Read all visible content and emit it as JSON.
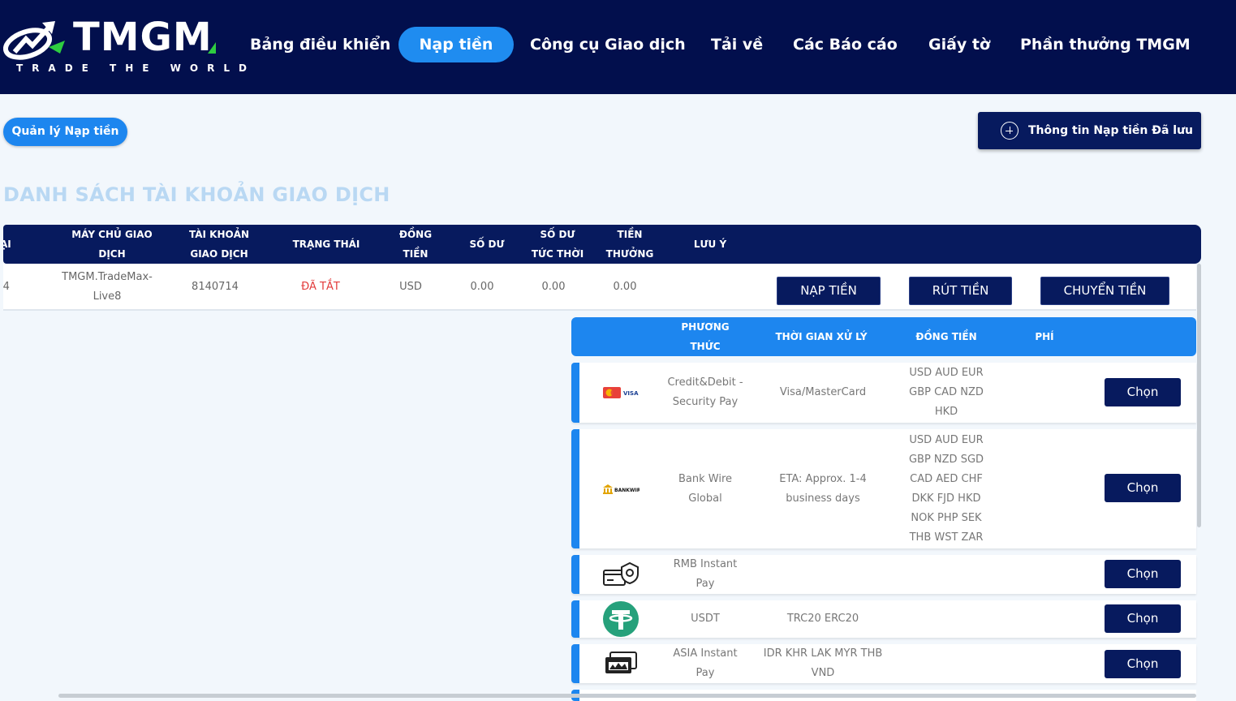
{
  "brand": {
    "name": "TMGM",
    "tagline": "TRADE THE WORLD"
  },
  "nav": {
    "items": [
      {
        "label": "Bảng điều khiển"
      },
      {
        "label": "Nạp tiền",
        "active": true
      },
      {
        "label": "Công cụ Giao dịch"
      },
      {
        "label": "Tải về"
      },
      {
        "label": "Các Báo cáo"
      },
      {
        "label": "Giấy tờ"
      },
      {
        "label": "Phần thưởng TMGM"
      }
    ]
  },
  "sub": {
    "manage_label": "Quản lý Nạp tiền",
    "saved_label": "Thông tin Nạp tiền Đã lưu"
  },
  "section_title": "DANH SÁCH TÀI KHOẢN GIAO DỊCH",
  "accounts": {
    "headers": [
      "ẠI",
      "MÁY CHỦ GIAO DỊCH",
      "TÀI KHOẢN GIAO DỊCH",
      "TRẠNG THÁI",
      "ĐỒNG TIỀN",
      "SỐ DƯ",
      "SỐ DƯ TỨC THỜI",
      "TIỀN THƯỞNG",
      "LƯU Ý"
    ],
    "row": {
      "type": "'4",
      "server": "TMGM.TradeMax-Live8",
      "account": "8140714",
      "status": "ĐÃ TẮT",
      "currency": "USD",
      "balance": "0.00",
      "instant_balance": "0.00",
      "bonus": "0.00",
      "note": ""
    },
    "actions": {
      "deposit": "NẠP TIỀN",
      "withdraw": "RÚT TIỀN",
      "transfer": "CHUYỂN TIỀN"
    }
  },
  "methods": {
    "headers": [
      "PHƯƠNG THỨC",
      "THỜI GIAN XỬ LÝ",
      "ĐỒNG TIỀN",
      "PHÍ"
    ],
    "choose_label": "Chọn",
    "rows": [
      {
        "icon": "visa-mastercard-icon",
        "method": "Credit&Debit - Security Pay",
        "time": "Visa/MasterCard",
        "currencies": "USD AUD EUR GBP CAD NZD HKD",
        "fee": ""
      },
      {
        "icon": "bank-wire-icon",
        "method": "Bank Wire Global",
        "time": "ETA: Approx. 1-4 business days",
        "currencies": "USD AUD EUR GBP NZD SGD CAD AED CHF DKK FJD HKD NOK PHP SEK THB WST ZAR",
        "fee": ""
      },
      {
        "icon": "rmb-instant-pay-icon",
        "method": "RMB Instant Pay",
        "time": "",
        "currencies": "",
        "fee": ""
      },
      {
        "icon": "usdt-tether-icon",
        "method": "USDT",
        "time": "TRC20 ERC20",
        "currencies": "",
        "fee": ""
      },
      {
        "icon": "asia-instant-pay-icon",
        "method": "ASIA Instant Pay",
        "time": "IDR KHR LAK MYR THB VND",
        "currencies": "",
        "fee": ""
      }
    ]
  },
  "colors": {
    "navy": "#020f4d",
    "button_navy": "#071a5e",
    "accent_blue": "#1d86ef",
    "status_red": "#e23b3b",
    "title_light": "#b9d8f3"
  }
}
